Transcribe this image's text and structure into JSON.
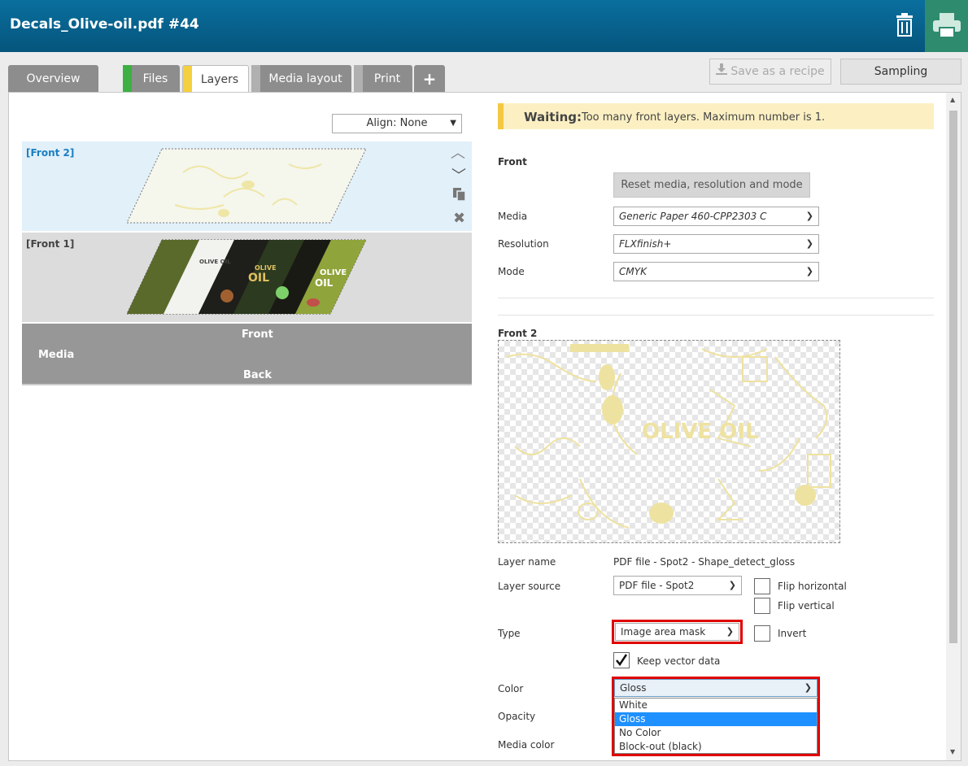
{
  "window": {
    "title": "Decals_Olive-oil.pdf #44"
  },
  "icons": {
    "trash": "trash-icon",
    "print": "printer-icon",
    "download": "download-icon"
  },
  "tabs": [
    {
      "label": "Overview",
      "color": ""
    },
    {
      "label": "Files",
      "color": "#3cb043"
    },
    {
      "label": "Layers",
      "color": "#f4d03f"
    },
    {
      "label": "Media layout",
      "color": "#b0b0b0"
    },
    {
      "label": "Print",
      "color": "#b0b0b0"
    },
    {
      "label": "+",
      "color": ""
    }
  ],
  "toolbar": {
    "save_recipe": "Save as a recipe",
    "sampling": "Sampling"
  },
  "left": {
    "align": "Align: None",
    "layers": [
      {
        "name": "[Front 2]"
      },
      {
        "name": "[Front 1]"
      }
    ],
    "media_block": {
      "front": "Front",
      "media": "Media",
      "back": "Back"
    },
    "olive_text": [
      "OLIVE OIL",
      "OLIVE",
      "OIL",
      "OLIVE",
      "OIL"
    ]
  },
  "right": {
    "warning": {
      "status": "Waiting:",
      "message": "Too many front layers. Maximum number is 1."
    },
    "front": {
      "heading": "Front",
      "reset_button": "Reset media, resolution and mode",
      "media_label": "Media",
      "media_value": "Generic Paper 460-CPP2303 C",
      "resolution_label": "Resolution",
      "resolution_value": "FLXfinish+",
      "mode_label": "Mode",
      "mode_value": "CMYK"
    },
    "front2": {
      "heading": "Front 2",
      "preview_text": "OLIVE OIL",
      "layer_name_label": "Layer name",
      "layer_name_value": "PDF file - Spot2 - Shape_detect_gloss",
      "layer_source_label": "Layer source",
      "layer_source_value": "PDF file - Spot2",
      "flip_horizontal": "Flip horizontal",
      "flip_vertical": "Flip vertical",
      "type_label": "Type",
      "type_value": "Image area mask",
      "invert": "Invert",
      "keep_vector": "Keep vector data",
      "color_label": "Color",
      "color_value": "Gloss",
      "color_options": [
        "White",
        "Gloss",
        "No Color",
        "Block-out (black)"
      ],
      "opacity_label": "Opacity",
      "media_color_label": "Media color"
    }
  }
}
